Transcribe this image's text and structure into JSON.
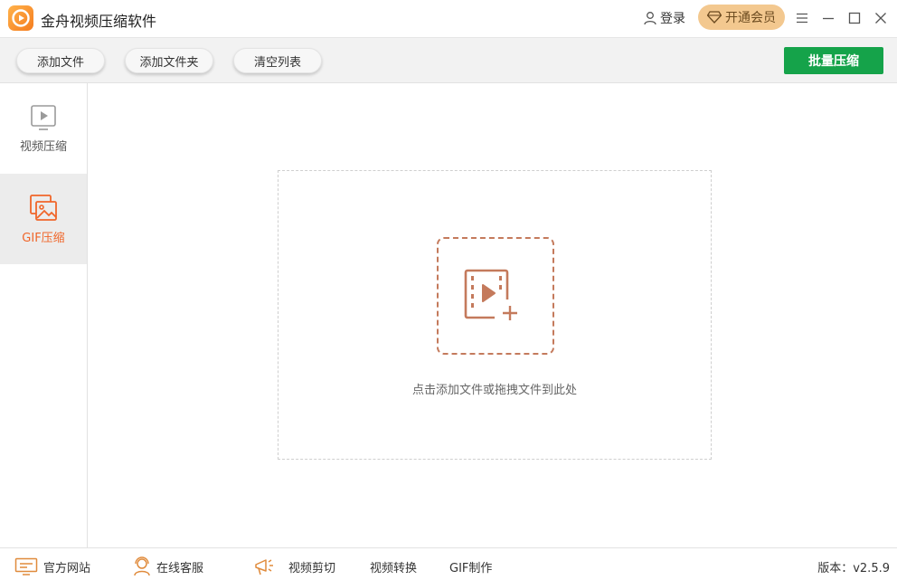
{
  "app": {
    "title": "金舟视频压缩软件"
  },
  "header": {
    "login_label": "登录",
    "vip_label": "开通会员"
  },
  "toolbar": {
    "add_file_label": "添加文件",
    "add_folder_label": "添加文件夹",
    "clear_list_label": "清空列表",
    "batch_compress_label": "批量压缩"
  },
  "sidebar": {
    "items": [
      {
        "label": "视频压缩",
        "icon": "video-play-icon",
        "active": false
      },
      {
        "label": "GIF压缩",
        "icon": "image-icon",
        "active": true
      }
    ]
  },
  "main": {
    "drop_hint": "点击添加文件或拖拽文件到此处"
  },
  "footer": {
    "official_site_label": "官方网站",
    "online_service_label": "在线客服",
    "video_cut_label": "视频剪切",
    "video_convert_label": "视频转换",
    "gif_make_label": "GIF制作",
    "version_text": "版本：v2.5.9"
  },
  "colors": {
    "accent": "#f0662a",
    "primary_green": "#15a34a",
    "vip_gold": "#f3c88f",
    "dropzone_icon": "#c47a5c"
  }
}
